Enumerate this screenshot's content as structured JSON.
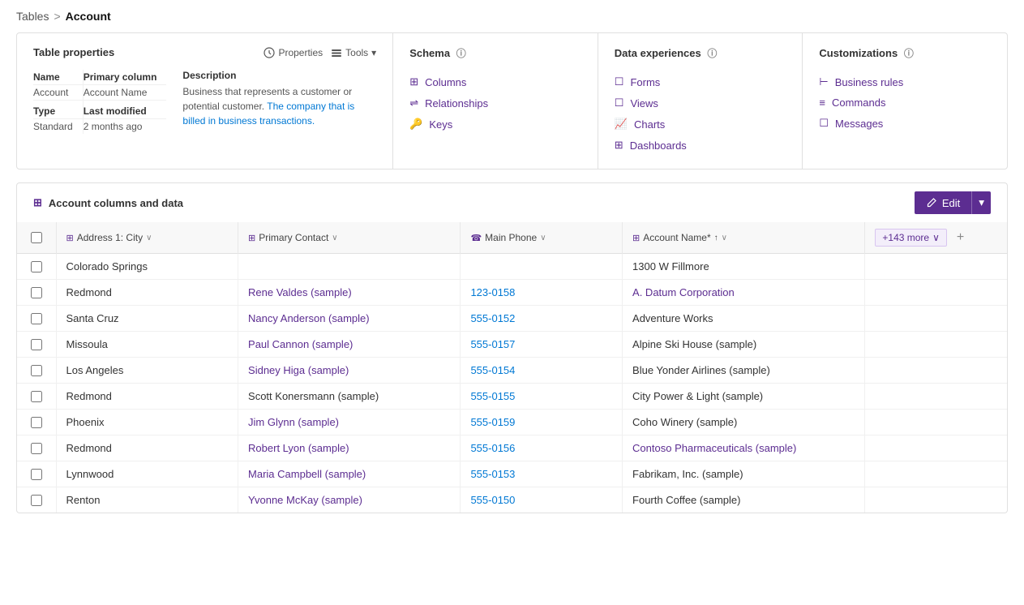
{
  "breadcrumb": {
    "link": "Tables",
    "separator": ">",
    "current": "Account"
  },
  "tableProperties": {
    "title": "Table properties",
    "tools": {
      "properties": "Properties",
      "tools": "Tools"
    },
    "labels": {
      "name": "Name",
      "primaryColumn": "Primary column",
      "description": "Description",
      "type": "Type",
      "lastModified": "Last modified"
    },
    "values": {
      "name": "Account",
      "primaryColumn": "Account Name",
      "type": "Standard",
      "lastModified": "2 months ago",
      "description": "Business that represents a customer or potential customer. The company that is billed in business transactions."
    }
  },
  "schema": {
    "title": "Schema",
    "items": [
      {
        "label": "Columns",
        "icon": "grid-icon"
      },
      {
        "label": "Relationships",
        "icon": "relationship-icon"
      },
      {
        "label": "Keys",
        "icon": "key-icon"
      }
    ]
  },
  "dataExperiences": {
    "title": "Data experiences",
    "items": [
      {
        "label": "Forms",
        "icon": "form-icon"
      },
      {
        "label": "Views",
        "icon": "view-icon"
      },
      {
        "label": "Charts",
        "icon": "chart-icon"
      },
      {
        "label": "Dashboards",
        "icon": "dashboard-icon"
      }
    ]
  },
  "customizations": {
    "title": "Customizations",
    "items": [
      {
        "label": "Business rules",
        "icon": "rules-icon"
      },
      {
        "label": "Commands",
        "icon": "commands-icon"
      },
      {
        "label": "Messages",
        "icon": "messages-icon"
      }
    ]
  },
  "accountColumnsSection": {
    "title": "Account columns and data",
    "editButton": "Edit"
  },
  "tableColumns": {
    "checkbox": "",
    "addressCity": "Address 1: City",
    "primaryContact": "Primary Contact",
    "mainPhone": "Main Phone",
    "accountName": "Account Name*",
    "moreCols": "+143 more"
  },
  "tableRows": [
    {
      "city": "Colorado Springs",
      "contact": "",
      "phone": "",
      "accountName": "1300 W Fillmore",
      "contactLink": false,
      "phoneLink": false,
      "nameLink": false
    },
    {
      "city": "Redmond",
      "contact": "Rene Valdes (sample)",
      "phone": "123-0158",
      "accountName": "A. Datum Corporation",
      "contactLink": true,
      "phoneLink": true,
      "nameLink": true
    },
    {
      "city": "Santa Cruz",
      "contact": "Nancy Anderson (sample)",
      "phone": "555-0152",
      "accountName": "Adventure Works",
      "contactLink": true,
      "phoneLink": true,
      "nameLink": false
    },
    {
      "city": "Missoula",
      "contact": "Paul Cannon (sample)",
      "phone": "555-0157",
      "accountName": "Alpine Ski House (sample)",
      "contactLink": true,
      "phoneLink": true,
      "nameLink": false
    },
    {
      "city": "Los Angeles",
      "contact": "Sidney Higa (sample)",
      "phone": "555-0154",
      "accountName": "Blue Yonder Airlines (sample)",
      "contactLink": true,
      "phoneLink": true,
      "nameLink": false
    },
    {
      "city": "Redmond",
      "contact": "Scott Konersmann (sample)",
      "phone": "555-0155",
      "accountName": "City Power & Light (sample)",
      "contactLink": false,
      "phoneLink": true,
      "nameLink": false
    },
    {
      "city": "Phoenix",
      "contact": "Jim Glynn (sample)",
      "phone": "555-0159",
      "accountName": "Coho Winery (sample)",
      "contactLink": true,
      "phoneLink": true,
      "nameLink": false
    },
    {
      "city": "Redmond",
      "contact": "Robert Lyon (sample)",
      "phone": "555-0156",
      "accountName": "Contoso Pharmaceuticals (sample)",
      "contactLink": true,
      "phoneLink": true,
      "nameLink": true
    },
    {
      "city": "Lynnwood",
      "contact": "Maria Campbell (sample)",
      "phone": "555-0153",
      "accountName": "Fabrikam, Inc. (sample)",
      "contactLink": true,
      "phoneLink": true,
      "nameLink": false
    },
    {
      "city": "Renton",
      "contact": "Yvonne McKay (sample)",
      "phone": "555-0150",
      "accountName": "Fourth Coffee (sample)",
      "contactLink": true,
      "phoneLink": true,
      "nameLink": false
    }
  ]
}
